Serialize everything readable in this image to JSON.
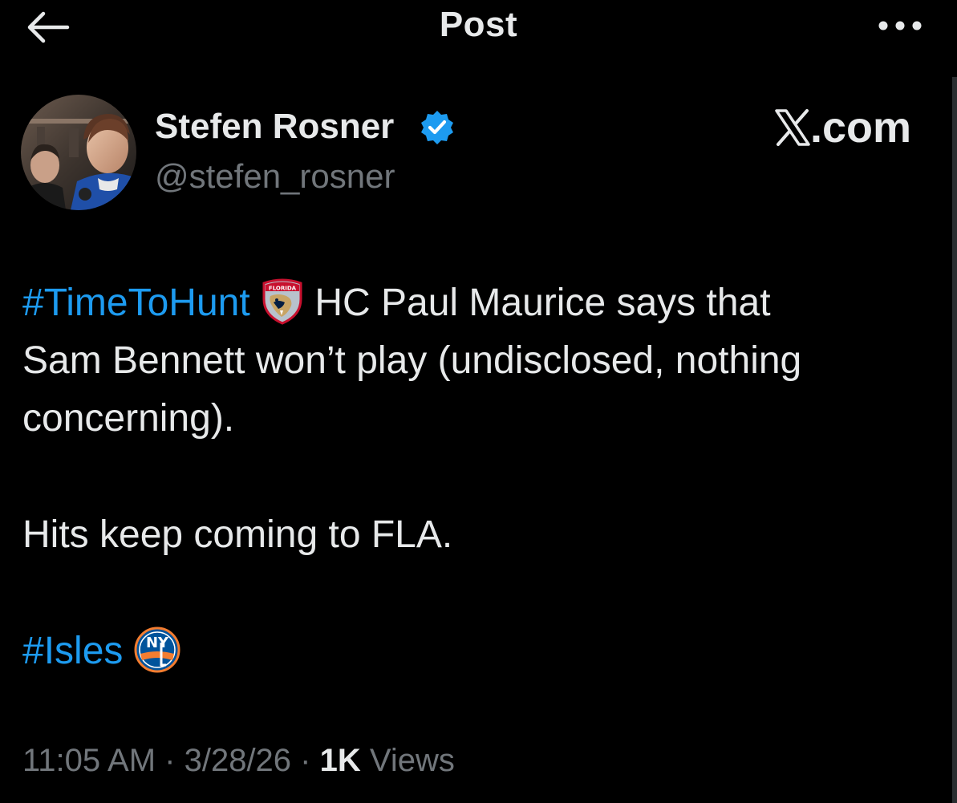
{
  "header": {
    "title": "Post",
    "back_icon": "arrow-left-icon",
    "more_icon": "more-horizontal-icon"
  },
  "author": {
    "name": "Stefen Rosner",
    "handle": "@stefen_rosner",
    "verified": true,
    "verified_color": "#1d9bf0",
    "avatar_icon": "profile-photo"
  },
  "watermark": {
    "label": ".com",
    "logo_icon": "x-logo-icon"
  },
  "post": {
    "line1_hashtag": "#TimeToHunt",
    "line1_emoji": "florida-panthers-logo-icon",
    "line1_text": " HC Paul Maurice says that",
    "line2_text": "Sam Bennett won’t play (undisclosed, nothing",
    "line3_text": "concerning).",
    "line4_text": "Hits keep coming to FLA.",
    "line5_hashtag": "#Isles",
    "line5_emoji": "ny-islanders-logo-icon",
    "panthers_logo_text": "FLORIDA",
    "islanders_logo_text": "NY"
  },
  "meta": {
    "time": "11:05 AM",
    "sep1": " · ",
    "date": "3/28/26",
    "sep2": " · ",
    "views_count": "1K",
    "views_label": " Views"
  },
  "colors": {
    "background": "#000000",
    "text_primary": "#e7e9ea",
    "text_secondary": "#71767b",
    "accent": "#1d9bf0"
  }
}
